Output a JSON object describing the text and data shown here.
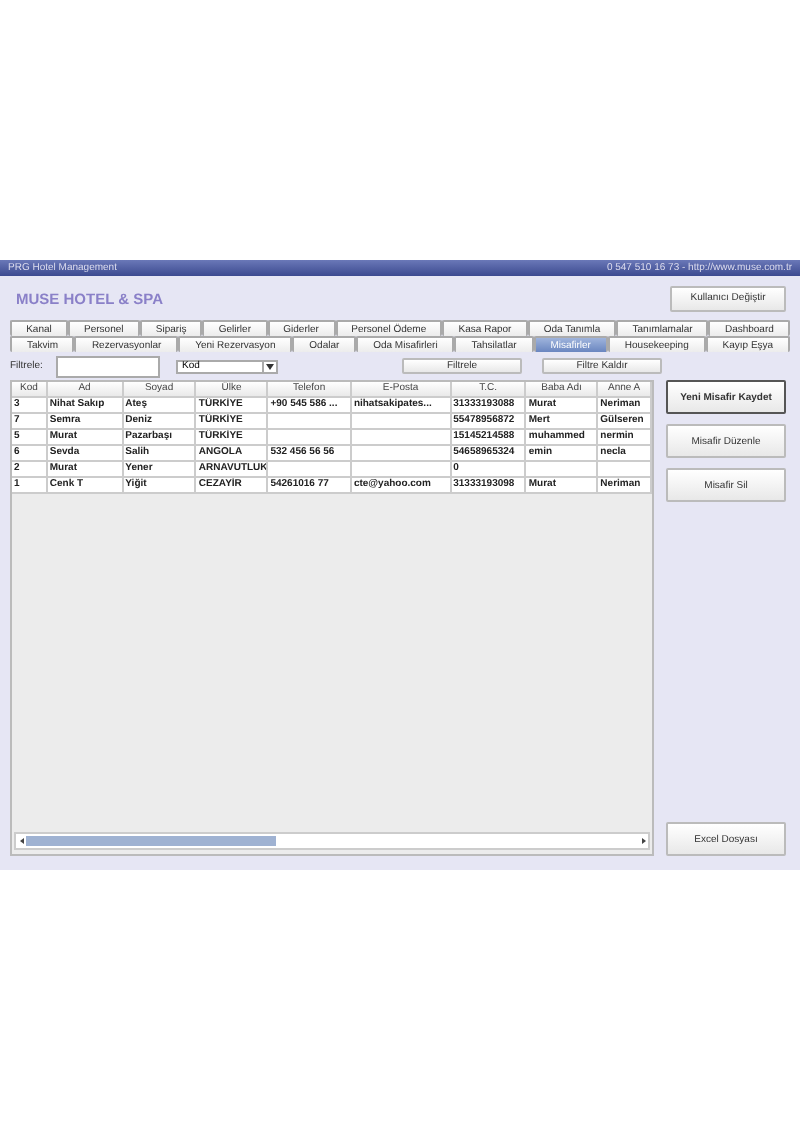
{
  "window": {
    "title": "PRG Hotel Management",
    "contact": "0 547 510 16 73 - http://www.muse.com.tr"
  },
  "header": {
    "brand": "MUSE HOTEL & SPA",
    "user_button": "Kullanıcı Değiştir"
  },
  "tabs": [
    [
      {
        "label": "Kanal",
        "selected": false
      },
      {
        "label": "Personel",
        "selected": false
      },
      {
        "label": "Sipariş",
        "selected": false
      },
      {
        "label": "Gelirler",
        "selected": false
      },
      {
        "label": "Giderler",
        "selected": false
      },
      {
        "label": "Personel Ödeme",
        "selected": false
      },
      {
        "label": "Kasa Rapor",
        "selected": false
      },
      {
        "label": "Oda Tanımla",
        "selected": false
      },
      {
        "label": "Tanımlamalar",
        "selected": false
      },
      {
        "label": "Dashboard",
        "selected": false
      }
    ],
    [
      {
        "label": "Takvim",
        "selected": false
      },
      {
        "label": "Rezervasyonlar",
        "selected": false
      },
      {
        "label": "Yeni Rezervasyon",
        "selected": false
      },
      {
        "label": "Odalar",
        "selected": false
      },
      {
        "label": "Oda Misafirleri",
        "selected": false
      },
      {
        "label": "Tahsilatlar",
        "selected": false
      },
      {
        "label": "Misafirler",
        "selected": true
      },
      {
        "label": "Housekeeping",
        "selected": false
      },
      {
        "label": "Kayıp Eşya",
        "selected": false
      }
    ]
  ],
  "filter": {
    "label": "Filtrele:",
    "field": "Kod",
    "apply_button": "Filtrele",
    "clear_button": "Filtre Kaldır"
  },
  "table": {
    "columns": [
      "Kod",
      "Ad",
      "Soyad",
      "Ülke",
      "Telefon",
      "E-Posta",
      "T.C.",
      "Baba Adı",
      "Anne A"
    ],
    "rows": [
      [
        "3",
        "Nihat Sakıp",
        "Ateş",
        "TÜRKİYE",
        "+90 545 586 ...",
        "nihatsakipates...",
        "31333193088",
        "Murat",
        "Neriman"
      ],
      [
        "7",
        "Semra",
        "Deniz",
        "TÜRKİYE",
        null,
        null,
        "55478956872",
        "Mert",
        "Gülseren"
      ],
      [
        "5",
        "Murat",
        "Pazarbaşı",
        "TÜRKİYE",
        null,
        null,
        "15145214588",
        "muhammed",
        "nermin"
      ],
      [
        "6",
        "Sevda",
        "Salih",
        "ANGOLA",
        "532 456 56 56",
        null,
        "54658965324",
        "emin",
        "necla"
      ],
      [
        "2",
        "Murat",
        "Yener",
        "ARNAVUTLUK",
        null,
        null,
        "0",
        null,
        null
      ],
      [
        "1",
        "Cenk T",
        "Yiğit",
        "CEZAYİR",
        "54261016 77",
        "cte@yahoo.com",
        "31333193098",
        "Murat",
        "Neriman"
      ]
    ]
  },
  "actions": [
    {
      "label": "Yeni Misafir Kaydet",
      "kind": "primary"
    },
    {
      "label": "Misafir Düzenle",
      "kind": "normal"
    },
    {
      "label": "Misafir Sil",
      "kind": "normal"
    }
  ],
  "export_button": "Excel Dosyası"
}
